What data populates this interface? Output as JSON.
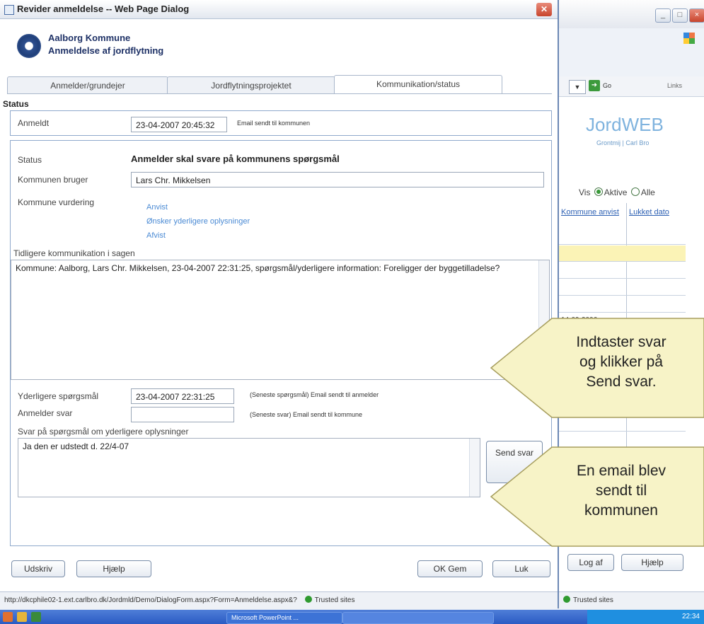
{
  "dialog": {
    "title": "Revider anmeldelse -- Web Page Dialog",
    "org_name": "Aalborg Kommune",
    "org_subtitle": "Anmeldelse af jordflytning",
    "tabs": [
      "Anmelder/grundejer",
      "Jordflytningsprojektet",
      "Kommunikation/status"
    ],
    "active_tab": "Kommunikation/status",
    "section_heading": "Status",
    "anmeldt": {
      "label": "Anmeldt",
      "value": "23-04-2007 20:45:32",
      "note": "Email sendt til kommunen"
    },
    "status": {
      "label": "Status",
      "value": "Anmelder skal svare på kommunens spørgsmål"
    },
    "kommunen_bruger": {
      "label": "Kommunen bruger",
      "value": "Lars Chr. Mikkelsen"
    },
    "kommune_vurdering": {
      "label": "Kommune vurdering",
      "options": [
        "Anvist",
        "Ønsker yderligere oplysninger",
        "Afvist"
      ]
    },
    "tidligere": {
      "label": "Tidligere kommunikation i sagen",
      "text": "Kommune: Aalborg, Lars Chr. Mikkelsen, 23-04-2007 22:31:25, spørgsmål/yderligere information: Foreligger der byggetilladelse?"
    },
    "yderligere": {
      "label": "Yderligere spørgsmål",
      "value": "23-04-2007 22:31:25",
      "note": "(Seneste spørgsmål) Email sendt til anmelder"
    },
    "anmelder_svar": {
      "label": "Anmelder svar",
      "value": "",
      "note": "(Seneste svar) Email sendt til kommune"
    },
    "svar_label": "Svar på spørgsmål om yderligere oplysninger",
    "svar_text": "Ja den er udstedt d. 22/4-07",
    "send_button": "Send svar",
    "buttons": {
      "udskriv": "Udskriv",
      "hjaelp": "Hjælp",
      "ok_gem": "OK Gem",
      "luk": "Luk"
    },
    "status_bar": {
      "url": "http://dkcphile02-1.ext.carlbro.dk/Jordmld/Demo/DialogForm.aspx?Form=Anmeldelse.aspx&?",
      "zone": "Trusted sites"
    }
  },
  "background_window": {
    "go_label": "Go",
    "links_label": "Links",
    "brand": "JordWEB",
    "brand_sub": "Grontmij | Carl Bro",
    "vis_label": "Vis",
    "vis_options": [
      "Aktive",
      "Alle"
    ],
    "vis_selected": "Aktive",
    "grid_headers": [
      "Kommune anvist",
      "Lukket dato"
    ],
    "grid_value": "14-09-2006",
    "log_af": "Log af",
    "hjaelp": "Hjælp",
    "zone": "Trusted sites"
  },
  "taskbar": {
    "items": [
      "Microsoft PowerPoint ...",
      ""
    ],
    "clock": "22:34"
  },
  "callouts": {
    "first": [
      "Indtaster svar",
      "og klikker på",
      "Send svar."
    ],
    "second": [
      "En email blev",
      "sendt til",
      "kommunen"
    ]
  },
  "colors": {
    "accent": "#2d4f8f",
    "callout_fill": "#f7f3c7",
    "link": "#4a8ad4",
    "highlight_row": "#fbf3b6"
  }
}
